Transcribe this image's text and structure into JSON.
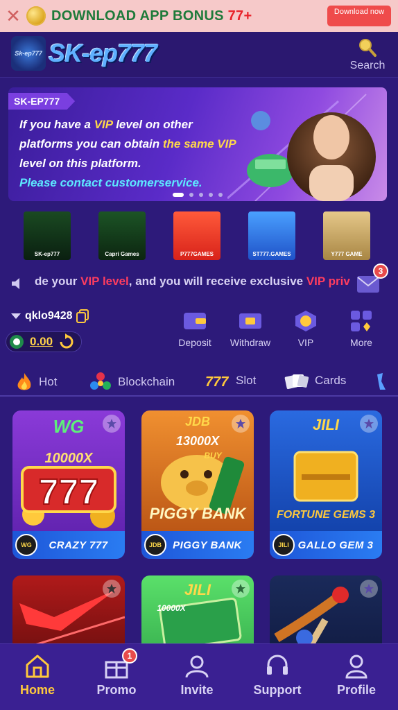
{
  "download_bar": {
    "close_glyph": "✕",
    "text": "DOWNLOAD APP BONUS ",
    "bonus": "77+",
    "button_label": "Download now"
  },
  "header": {
    "logo_text": "SK-ep777",
    "logo_emblem_text": "Sk-ep777",
    "search_label": "Search"
  },
  "hero": {
    "tag": "SK-EP777",
    "line1_pre": "If you have a ",
    "line1_vip": "VIP",
    "line1_post": " level on other",
    "line2_pre": "platforms you can obtain ",
    "line2_vip": "the same VIP",
    "line3": "level on this platform.",
    "line4": "Please contact customerservice.",
    "slide_count": 5,
    "active_slide": 1
  },
  "providers": [
    {
      "name": "SK-ep777",
      "color": "#0f3a1a"
    },
    {
      "name": "Capri Games",
      "color": "#14421c"
    },
    {
      "name": "P777GAMES",
      "color": "#e8322a"
    },
    {
      "name": "ST777.GAMES",
      "color": "#2a6de0"
    },
    {
      "name": "Y777 GAME",
      "color": "#c9a65a"
    }
  ],
  "marquee": {
    "part1": "de your ",
    "part2": "VIP level",
    "part3": ", and you will receive exclusive ",
    "part4": "VIP priv",
    "mail_badge": "3"
  },
  "user": {
    "username": "qklo9428",
    "balance": "0.00"
  },
  "actions": [
    {
      "label": "Deposit",
      "icon": "wallet-icon"
    },
    {
      "label": "Withdraw",
      "icon": "withdraw-icon"
    },
    {
      "label": "VIP",
      "icon": "vip-icon"
    },
    {
      "label": "More",
      "icon": "more-icon"
    }
  ],
  "categories": [
    {
      "label": "Hot",
      "icon": "fire-icon"
    },
    {
      "label": "Blockchain",
      "icon": "blockchain-icon"
    },
    {
      "label": "Slot",
      "icon": "slot-777-icon"
    },
    {
      "label": "Cards",
      "icon": "cards-icon"
    }
  ],
  "games": [
    {
      "title": "CRAZY 777",
      "badge": "WG",
      "art_label": "WG",
      "sub_label": "10000X"
    },
    {
      "title": "PIGGY BANK",
      "badge": "JDB",
      "art_label": "JDB",
      "sub_label": "13000X",
      "extra": "BUY",
      "art_title": "PIGGY BANK"
    },
    {
      "title": "GALLO GEM 3",
      "badge": "JILI",
      "art_label": "JILI",
      "art_title": "FORTUNE GEMS 3"
    },
    {
      "title": "",
      "badge": "",
      "art_label": ""
    },
    {
      "title": "",
      "badge": "",
      "art_label": "JILI",
      "sub_label": "10000X"
    },
    {
      "title": "",
      "badge": "",
      "art_label": ""
    }
  ],
  "bottom_nav": [
    {
      "label": "Home",
      "icon": "home-icon",
      "active": true
    },
    {
      "label": "Promo",
      "icon": "gift-icon",
      "badge": "1"
    },
    {
      "label": "Invite",
      "icon": "invite-icon"
    },
    {
      "label": "Support",
      "icon": "headset-icon"
    },
    {
      "label": "Profile",
      "icon": "profile-icon"
    }
  ],
  "colors": {
    "background": "#2d1a7a",
    "accent_gold": "#ffc93c",
    "accent_red": "#ff3d5f",
    "nav_bg": "#3a2092"
  }
}
